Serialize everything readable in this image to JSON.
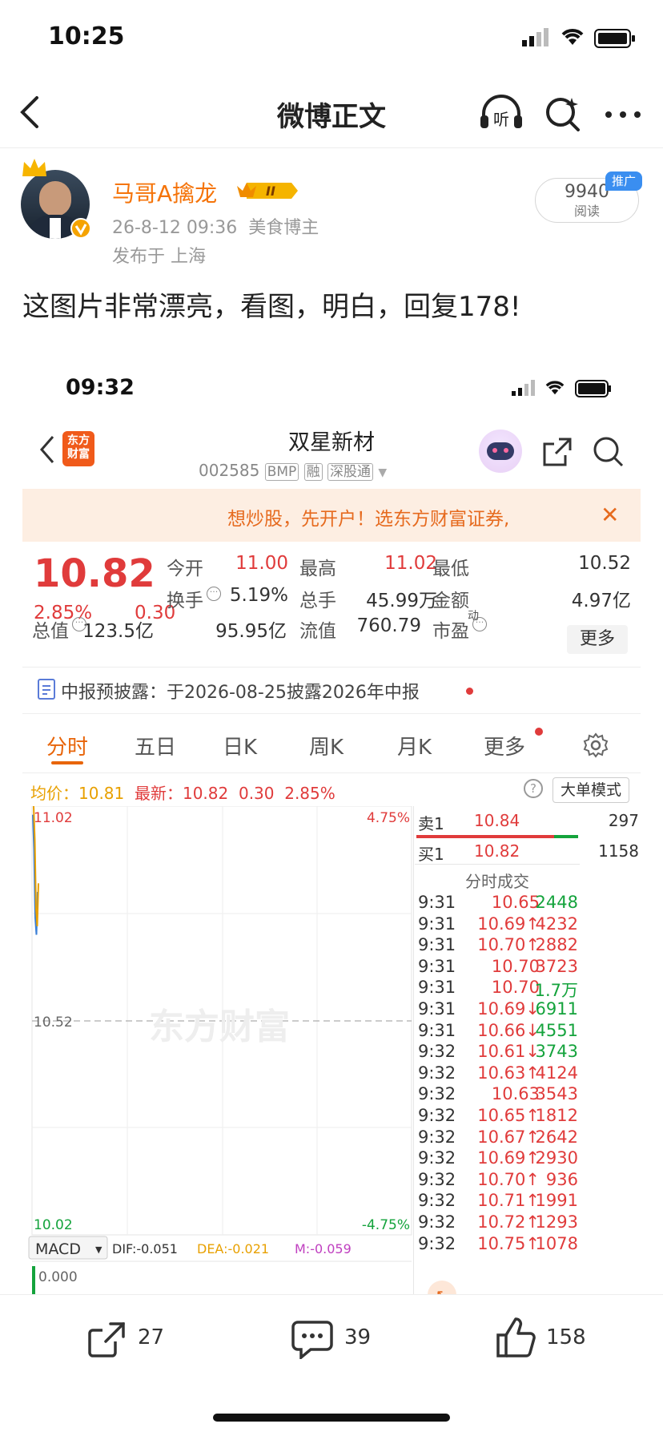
{
  "status_bar": {
    "time": "10:25"
  },
  "nav": {
    "title": "微博正文"
  },
  "post": {
    "author": "马哥A擒龙",
    "level_badge": "II",
    "datetime": "26-8-12 09:36",
    "role": "美食博主",
    "location": "发布于 上海",
    "reads": "9940",
    "reads_label": "阅读",
    "promo_tag": "推广",
    "text": "这图片非常漂亮，看图，明白，回复178!"
  },
  "screenshot": {
    "status_time": "09:32",
    "stock_name": "双星新材",
    "stock_code": "002585",
    "tags": [
      "BMP",
      "融",
      "深股通"
    ],
    "app_logo": "东方\n财富",
    "banner": "想炒股，先开户！选东方财富证券,",
    "price": "10.82",
    "change_pct": "2.85%",
    "change_amt": "0.30",
    "stats": [
      {
        "label": "今开",
        "value": "11.00",
        "color": "#e03b3b"
      },
      {
        "label": "最高",
        "value": "11.02",
        "color": "#e03b3b"
      },
      {
        "label": "最低",
        "value": "10.52",
        "color": "#333333"
      },
      {
        "label": "换手",
        "value": "5.19%",
        "color": "#333333"
      },
      {
        "label": "总手",
        "value": "45.99万",
        "color": "#333333"
      },
      {
        "label": "金额",
        "value": "4.97亿",
        "color": "#333333"
      },
      {
        "label": "总值",
        "value": "123.5亿",
        "color": "#333333"
      },
      {
        "label": "流值",
        "value": "95.95亿",
        "color": "#333333"
      },
      {
        "label": "市盈",
        "value": "760.79",
        "color": "#333333"
      }
    ],
    "pe_sup": "动",
    "more_button": "更多",
    "notice": "中报预披露：于2026-08-25披露2026年中报",
    "tabs": [
      "分时",
      "五日",
      "日K",
      "周K",
      "月K",
      "更多"
    ],
    "avg_label": "均价：",
    "avg_value": "10.81",
    "latest_label": "最新：",
    "latest_value": "10.82",
    "latest_chg": "0.30",
    "latest_pct": "2.85%",
    "big_order": "大单模式",
    "watermark": "东方财富",
    "macd": {
      "label": "MACD",
      "dif": "DIF:-0.051",
      "dea": "DEA:-0.021",
      "m": "M:-0.059",
      "axis_val": "0.000"
    },
    "order_book": {
      "sell_label": "卖1",
      "sell_price": "10.84",
      "sell_vol": "297",
      "buy_label": "买1",
      "buy_price": "10.82",
      "buy_vol": "1158",
      "trades_title": "分时成交"
    },
    "trades": [
      {
        "t": "9:31",
        "p": "10.65",
        "v": "2448",
        "pc": "red",
        "vc": "green"
      },
      {
        "t": "9:31",
        "p": "10.69↑",
        "v": "4232",
        "pc": "red",
        "vc": "red"
      },
      {
        "t": "9:31",
        "p": "10.70↑",
        "v": "2882",
        "pc": "red",
        "vc": "red"
      },
      {
        "t": "9:31",
        "p": "10.70",
        "v": "3723",
        "pc": "red",
        "vc": "red"
      },
      {
        "t": "9:31",
        "p": "10.70",
        "v": "1.7万",
        "pc": "red",
        "vc": "green"
      },
      {
        "t": "9:31",
        "p": "10.69↓",
        "v": "6911",
        "pc": "red",
        "vc": "green"
      },
      {
        "t": "9:31",
        "p": "10.66↓",
        "v": "4551",
        "pc": "red",
        "vc": "green"
      },
      {
        "t": "9:32",
        "p": "10.61↓",
        "v": "3743",
        "pc": "red",
        "vc": "green"
      },
      {
        "t": "9:32",
        "p": "10.63↑",
        "v": "4124",
        "pc": "red",
        "vc": "red"
      },
      {
        "t": "9:32",
        "p": "10.63",
        "v": "3543",
        "pc": "red",
        "vc": "red"
      },
      {
        "t": "9:32",
        "p": "10.65↑",
        "v": "1812",
        "pc": "red",
        "vc": "red"
      },
      {
        "t": "9:32",
        "p": "10.67↑",
        "v": "2642",
        "pc": "red",
        "vc": "red"
      },
      {
        "t": "9:32",
        "p": "10.69↑",
        "v": "2930",
        "pc": "red",
        "vc": "red"
      },
      {
        "t": "9:32",
        "p": "10.70↑",
        "v": "936",
        "pc": "red",
        "vc": "red"
      },
      {
        "t": "9:32",
        "p": "10.71↑",
        "v": "1991",
        "pc": "red",
        "vc": "red"
      },
      {
        "t": "9:32",
        "p": "10.72↑",
        "v": "1293",
        "pc": "red",
        "vc": "red"
      },
      {
        "t": "9:32",
        "p": "10.75↑",
        "v": "1078",
        "pc": "red",
        "vc": "red"
      }
    ],
    "chart_data": {
      "type": "line",
      "title": "",
      "y_top_left": "11.02",
      "y_mid_left": "10.52",
      "y_bottom_left": "10.02",
      "y_top_right": "4.75%",
      "y_bottom_right": "-4.75%",
      "ylim": [
        10.02,
        11.02
      ],
      "series": [
        {
          "values": [
            11.0,
            10.92,
            10.76,
            10.72,
            10.82
          ]
        }
      ]
    }
  },
  "actions": {
    "repost": "27",
    "comment": "39",
    "like": "158"
  },
  "colors": {
    "accent": "#f5740a",
    "up": "#e03b3b",
    "down": "#14a33c"
  }
}
